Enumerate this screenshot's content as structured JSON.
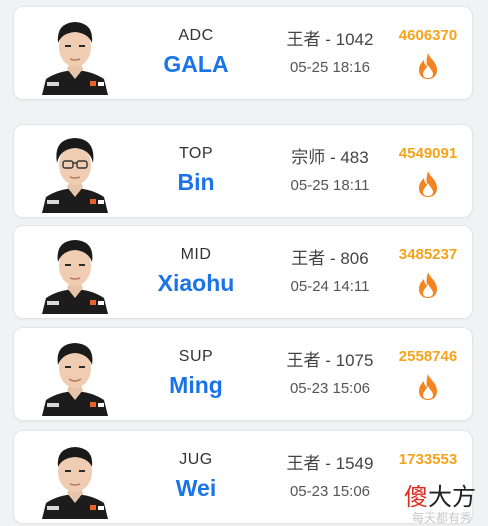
{
  "players": [
    {
      "role": "ADC",
      "name": "GALA",
      "rank": "王者 - 1042",
      "time": "05-25 18:16",
      "score": "4606370",
      "icon": "fire-icon"
    },
    {
      "role": "TOP",
      "name": "Bin",
      "rank": "宗师 - 483",
      "time": "05-25 18:11",
      "score": "4549091",
      "icon": "fire-icon"
    },
    {
      "role": "MID",
      "name": "Xiaohu",
      "rank": "王者 - 806",
      "time": "05-24 14:11",
      "score": "3485237",
      "icon": "fire-icon"
    },
    {
      "role": "SUP",
      "name": "Ming",
      "rank": "王者 - 1075",
      "time": "05-23 15:06",
      "score": "2558746",
      "icon": "fire-icon"
    },
    {
      "role": "JUG",
      "name": "Wei",
      "rank": "王者 - 1549",
      "time": "05-23 15:06",
      "score": "1733553",
      "icon": ""
    }
  ],
  "watermark": {
    "part1": "傻",
    "part2": "大方",
    "sub": "每天都有秀"
  },
  "colors": {
    "name": "#1a73e8",
    "score": "#f5a31a",
    "fire": "#f5831f",
    "watermark_red": "#e02a20"
  }
}
